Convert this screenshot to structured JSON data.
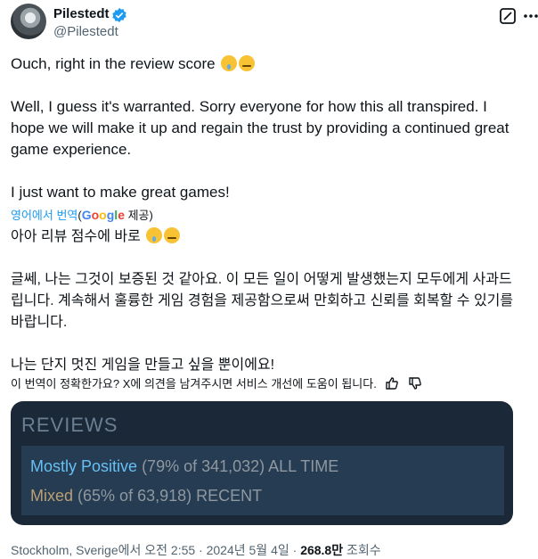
{
  "author": {
    "display_name": "Pilestedt",
    "handle": "@Pilestedt"
  },
  "icons": {
    "verified": "verified-badge-icon",
    "grok": "grok-icon",
    "more": "more-options-icon",
    "thumbs_up": "thumbs-up-icon",
    "thumbs_down": "thumbs-down-icon",
    "sad_emoji": "sad-relieved-face-emoji",
    "relieved_emoji": "relieved-face-emoji"
  },
  "tweet": {
    "line1": "Ouch, right in the review score",
    "para2": "Well, I guess it's warranted. Sorry everyone for how this all transpired. I hope we will make it up and regain the trust by providing a continued great game experience.",
    "para3": "I just want to make great games!"
  },
  "translation": {
    "link_label": "영어에서 번역",
    "provider_prefix": "(",
    "provider_suffix": " 제공)",
    "line1": "아아 리뷰 점수에 바로",
    "para2": "글쎄, 나는 그것이 보증된 것 같아요. 이 모든 일이 어떻게 발생했는지 모두에게 사과드립니다. 계속해서 훌륭한 게임 경험을 제공함으로써 만회하고 신뢰를 회복할 수 있기를 바랍니다.",
    "para3": "나는 단지 멋진 게임을 만들고 싶을 뿐이에요!",
    "feedback_prompt": "이 번역이 정확한가요? X에 의견을 남겨주시면 서비스 개선에 도움이 됩니다."
  },
  "media": {
    "title": "REVIEWS",
    "all_time_rating": "Mostly Positive",
    "all_time_detail": "(79% of 341,032) ALL TIME",
    "recent_rating": "Mixed",
    "recent_detail": "(65% of 63,918) RECENT",
    "colors": {
      "background": "#1b2838",
      "panel": "#263c52",
      "positive": "#66c0f4",
      "mixed": "#b9a074"
    }
  },
  "meta": {
    "location_time": "Stockholm, Sverige에서 오전 2:55 · 2024년 5월 4일 · ",
    "views_count": "268.8만",
    "views_label": " 조회수"
  }
}
